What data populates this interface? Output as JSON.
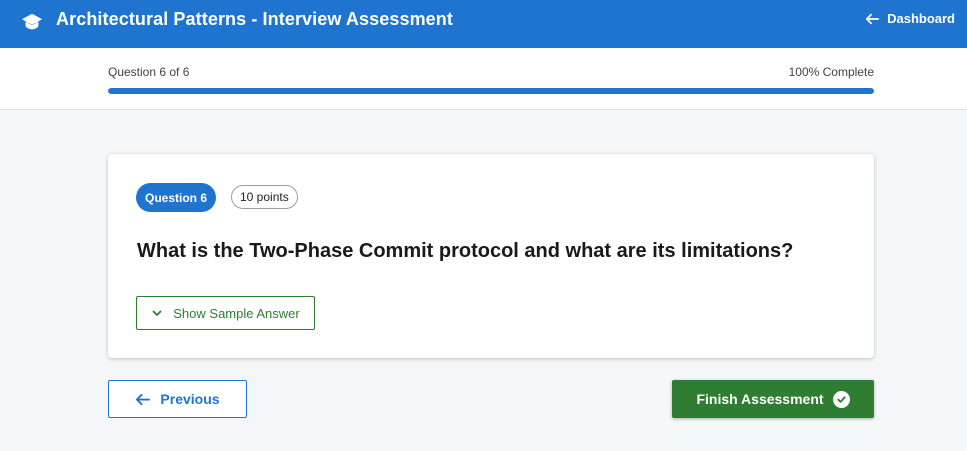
{
  "header": {
    "title": "Architectural Patterns - Interview Assessment",
    "back_label": "Dashboard",
    "logo_icon": "graduation-cap-icon",
    "back_icon": "arrow-left-icon"
  },
  "progress": {
    "label": "Question 6 of 6",
    "percent_label": "100% Complete",
    "fraction": 1.0
  },
  "question": {
    "badge": "Question 6",
    "points": "10 points",
    "text": "What is the Two-Phase Commit protocol and what are its limitations?",
    "sample_answer_label": "Show Sample Answer"
  },
  "navigation": {
    "previous_label": "Previous",
    "finish_label": "Finish Assessment"
  },
  "colors": {
    "primary": "#1e74cf",
    "success": "#2e7d32",
    "background": "#f5f6f8"
  }
}
